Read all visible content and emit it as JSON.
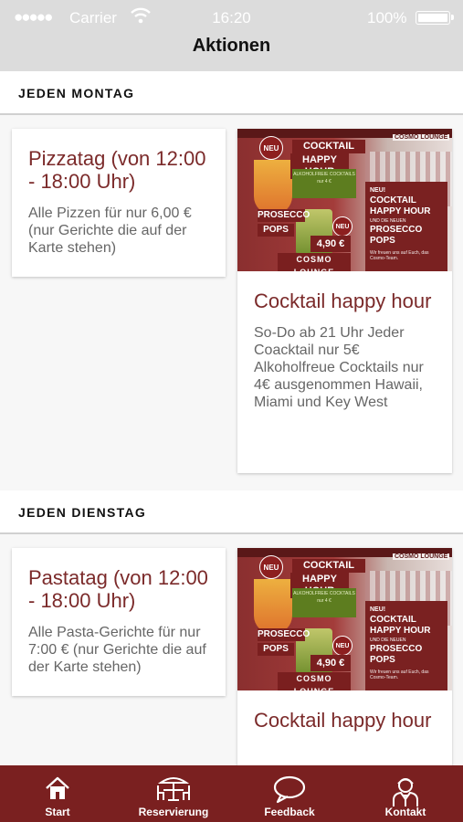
{
  "status_bar": {
    "signal": "●●●●●",
    "carrier": "Carrier",
    "time": "16:20",
    "battery_percent": "100%"
  },
  "header": {
    "title": "Aktionen"
  },
  "sections": [
    {
      "heading": "JEDEN MONTAG",
      "offer": {
        "title": "Pizzatag (von 12:00 - 18:00 Uhr)",
        "description": "Alle Pizzen für nur 6,00 € (nur Gerichte die auf der Karte stehen)"
      },
      "promo": {
        "title": "Cocktail happy hour",
        "description": "So-Do ab 21 Uhr Jeder Coacktail nur 5€ Alkoholfreue Cocktails nur 4€ ausgenommen Hawaii, Miami und Key West"
      }
    },
    {
      "heading": "JEDEN DIENSTAG",
      "offer": {
        "title": "Pastatag (von 12:00 - 18:00 Uhr)",
        "description": "Alle Pasta-Gerichte für nur 7:00 €  (nur Gerichte die auf der Karte stehen)"
      },
      "promo": {
        "title": "Cocktail happy hour"
      }
    }
  ],
  "flyer": {
    "neu": "NEU",
    "cocktail": "COCKTAIL",
    "happy_hour": "HAPPY HOUR",
    "prosecco": "PROSECCO",
    "pops": "POPS",
    "price": "4,90 €",
    "lounge": "COSMO LOUNGE",
    "logo": "COSMO LOUNGE",
    "small_info": "ALKOHOLFREIE COCKTAILS nur 4 €",
    "box_neu": "NEU!",
    "box_cocktail": "COCKTAIL HAPPY HOUR",
    "box_und": "UND DIE NEUEN",
    "box_prosecco": "PROSECCO POPS",
    "box_footer": "Wir freuen uns auf Euch, das Cosmo-Team."
  },
  "tabbar": {
    "color": "#7a2020",
    "items": [
      {
        "label": "Start",
        "icon": "home-icon"
      },
      {
        "label": "Reservierung",
        "icon": "table-icon"
      },
      {
        "label": "Feedback",
        "icon": "speech-bubble-icon"
      },
      {
        "label": "Kontakt",
        "icon": "person-icon"
      }
    ]
  }
}
